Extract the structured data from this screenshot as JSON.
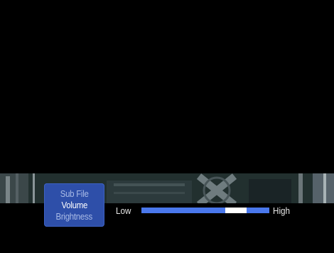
{
  "osd": {
    "menu": [
      {
        "label": "Sub File",
        "selected": false
      },
      {
        "label": "Volume",
        "selected": true
      },
      {
        "label": "Brightness",
        "selected": false
      }
    ],
    "slider": {
      "low_label": "Low",
      "high_label": "High",
      "level": 0.74
    }
  },
  "colors": {
    "panel": "#2e4fa9",
    "track": "#4a78ec",
    "thumb": "#ffffff"
  }
}
